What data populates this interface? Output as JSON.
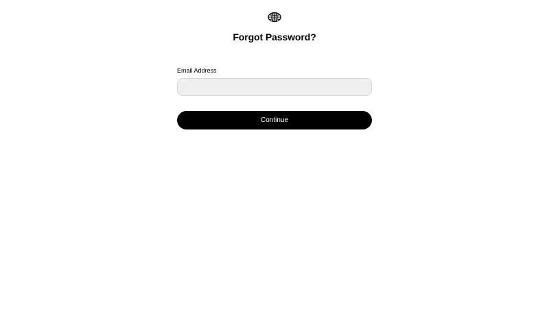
{
  "header": {
    "logo_icon": "globe-icon",
    "title": "Forgot Password?"
  },
  "form": {
    "email_label": "Email Address",
    "email_value": "",
    "email_placeholder": "",
    "continue_label": "Continue"
  },
  "colors": {
    "background": "#ffffff",
    "text": "#000000",
    "input_background": "#efefef",
    "input_border": "#d8d8d8",
    "button_background": "#000000",
    "button_text": "#ffffff"
  }
}
